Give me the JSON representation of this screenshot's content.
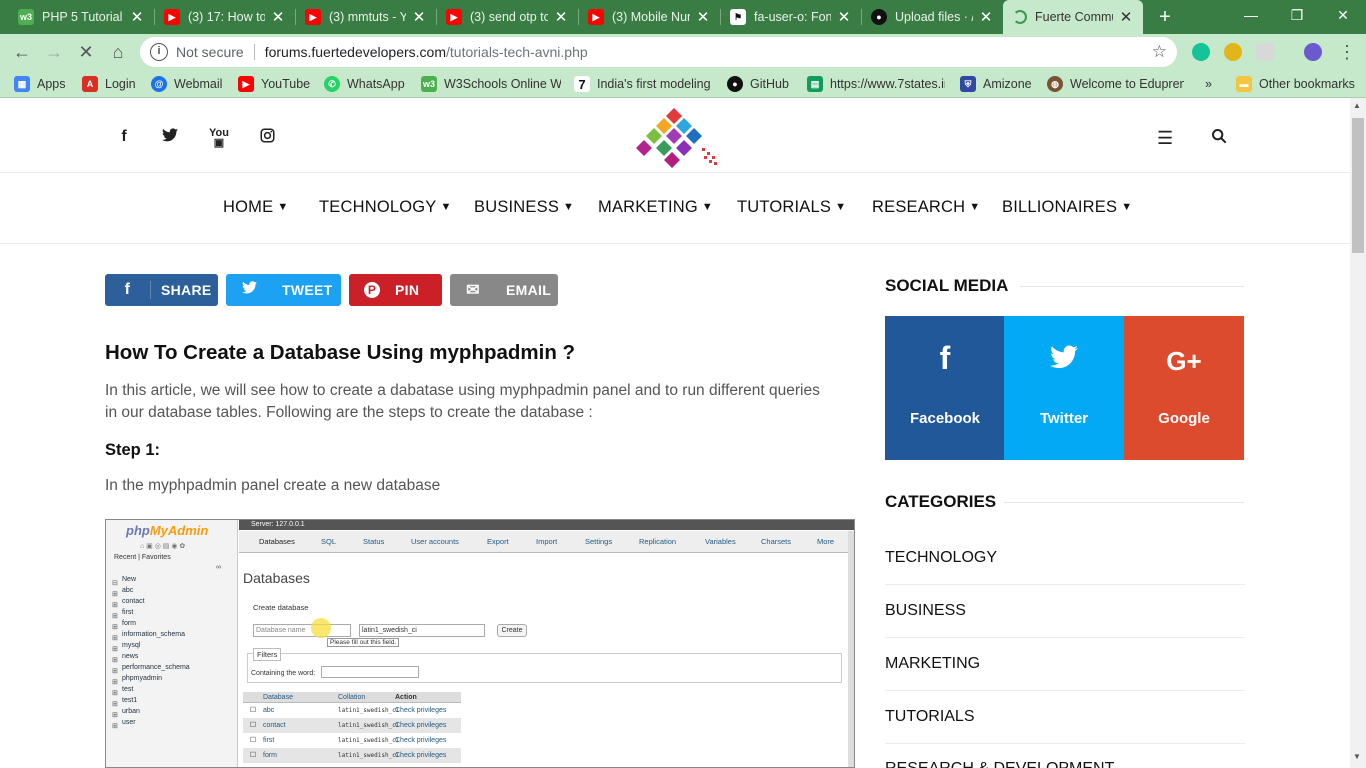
{
  "browser": {
    "tabs": [
      {
        "title": "PHP 5 Tutorial",
        "icon": "w3schools-icon",
        "color": "#4caf50"
      },
      {
        "title": "(3) 17: How to",
        "icon": "youtube-icon",
        "color": "#ff0000"
      },
      {
        "title": "(3) mmtuts - Y",
        "icon": "youtube-icon",
        "color": "#ff0000"
      },
      {
        "title": "(3) send otp to",
        "icon": "youtube-icon",
        "color": "#ff0000"
      },
      {
        "title": "(3) Mobile Nur",
        "icon": "youtube-icon",
        "color": "#ff0000"
      },
      {
        "title": "fa-user-o: Font",
        "icon": "flag-icon",
        "color": "#111111"
      },
      {
        "title": "Upload files · /",
        "icon": "github-icon",
        "color": "#111111"
      },
      {
        "title": "Fuerte Commu",
        "icon": "loading-icon",
        "color": "#3a9a4a",
        "active": true
      }
    ],
    "new_tab": "+",
    "window_controls": {
      "minimize": "—",
      "restore": "❐",
      "close": "✕"
    },
    "address": {
      "security": "Not secure",
      "host": "forums.fuertedevelopers.com",
      "path": "/tutorials-tech-avni.php"
    },
    "bookmarks": [
      {
        "label": "Apps",
        "icon": "apps-icon",
        "color": "#4285f4"
      },
      {
        "label": "Login",
        "icon": "login-icon",
        "color": "#d93025"
      },
      {
        "label": "Webmail",
        "icon": "webmail-icon",
        "color": "#1a73e8"
      },
      {
        "label": "YouTube",
        "icon": "youtube-icon",
        "color": "#ff0000"
      },
      {
        "label": "WhatsApp",
        "icon": "whatsapp-icon",
        "color": "#25d366"
      },
      {
        "label": "W3Schools Online W",
        "icon": "w3schools-icon",
        "color": "#4caf50"
      },
      {
        "label": "India's first modeling",
        "icon": "seven-icon",
        "color": "#111111"
      },
      {
        "label": "GitHub",
        "icon": "github-icon",
        "color": "#111111"
      },
      {
        "label": "https://www.7states.in",
        "icon": "sheet-icon",
        "color": "#0f9d58"
      },
      {
        "label": "Amizone",
        "icon": "shield-icon",
        "color": "#2f4aa0"
      },
      {
        "label": "Welcome to Edupren",
        "icon": "globe-icon",
        "color": "#7a5230"
      }
    ],
    "bookmarks_more": "»",
    "other_bookmarks": "Other bookmarks"
  },
  "site": {
    "social_icons": [
      "facebook-icon",
      "twitter-icon",
      "youtube-icon",
      "instagram-icon"
    ],
    "nav": [
      "HOME",
      "TECHNOLOGY",
      "BUSINESS",
      "MARKETING",
      "TUTORIALS",
      "RESEARCH",
      "BILLIONAIRES"
    ],
    "share_buttons": [
      {
        "label": "SHARE",
        "icon": "facebook-icon",
        "glyph": "f",
        "color": "#2d5f9a"
      },
      {
        "label": "TWEET",
        "icon": "twitter-icon",
        "glyph": "🐦",
        "color": "#1da1f2"
      },
      {
        "label": "PIN",
        "icon": "pinterest-icon",
        "glyph": "P",
        "color": "#cb2027"
      },
      {
        "label": "EMAIL",
        "icon": "email-icon",
        "glyph": "✉",
        "color": "#888888"
      }
    ]
  },
  "article": {
    "title": "How To Create a Database Using myphpadmin ?",
    "intro": "In this article, we will see how to create a dabatase using myphpadmin panel and to run different queries in our database tables. Following are the steps to create the database :",
    "step1_heading": "Step 1:",
    "step1_text": "In the myphpadmin panel create a new database"
  },
  "screenshot": {
    "logo_php": "php",
    "logo_my": "MyAdmin",
    "recent": "Recent",
    "favorites": "Favorites",
    "tree": [
      "New",
      "abc",
      "contact",
      "first",
      "form",
      "information_schema",
      "mysql",
      "news",
      "performance_schema",
      "phpmyadmin",
      "test",
      "test1",
      "urban",
      "user"
    ],
    "server": "Server: 127.0.0.1",
    "tabs": [
      "Databases",
      "SQL",
      "Status",
      "User accounts",
      "Export",
      "Import",
      "Settings",
      "Replication",
      "Variables",
      "Charsets",
      "More"
    ],
    "heading": "Databases",
    "create_label": "Create database",
    "db_placeholder": "Database name",
    "collation": "latin1_swedish_ci",
    "create_btn": "Create",
    "tooltip": "Please fill out this field.",
    "filters": "Filters",
    "containing": "Containing the word:",
    "col_db": "Database",
    "col_collation": "Collation",
    "col_action": "Action",
    "rows": [
      {
        "name": "abc",
        "collation": "latin1_swedish_ci",
        "action": "Check privileges"
      },
      {
        "name": "contact",
        "collation": "latin1_swedish_ci",
        "action": "Check privileges"
      },
      {
        "name": "first",
        "collation": "latin1_swedish_ci",
        "action": "Check privileges"
      },
      {
        "name": "form",
        "collation": "latin1_swedish_ci",
        "action": "Check privileges"
      }
    ]
  },
  "sidebar": {
    "social_heading": "SOCIAL MEDIA",
    "social": [
      {
        "label": "Facebook",
        "glyph": "f",
        "color": "#20589a"
      },
      {
        "label": "Twitter",
        "glyph": "🐦",
        "color": "#03a9f4"
      },
      {
        "label": "Google",
        "glyph": "G+",
        "color": "#dd4b2e"
      }
    ],
    "categories_heading": "CATEGORIES",
    "categories": [
      "TECHNOLOGY",
      "BUSINESS",
      "MARKETING",
      "TUTORIALS",
      "RESEARCH & DEVELOPMENT"
    ]
  }
}
